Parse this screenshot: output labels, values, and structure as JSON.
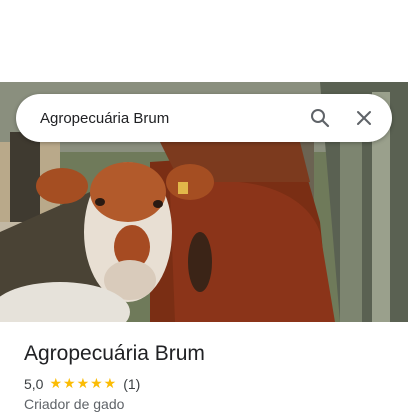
{
  "search": {
    "query": "Agropecuária Brum"
  },
  "icons": {
    "search": "search-icon",
    "close": "close-icon"
  },
  "place": {
    "name": "Agropecuária Brum",
    "rating": "5,0",
    "stars": "★★★★★",
    "review_count": "(1)",
    "category": "Criador de gado"
  },
  "colors": {
    "star": "#fbbc04",
    "text": "#202124"
  }
}
